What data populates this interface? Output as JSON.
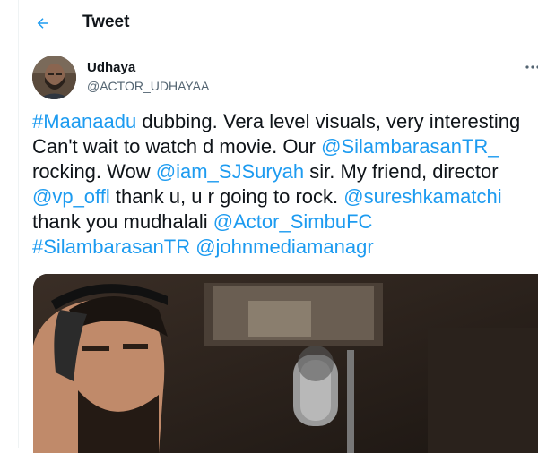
{
  "header": {
    "title": "Tweet",
    "back_icon": "arrow-left-icon",
    "accent_color": "#1d9bf0"
  },
  "tweet": {
    "author": {
      "name": "Udhaya",
      "handle": "@ACTOR_UDHAYAA"
    },
    "more_icon": "ellipsis-icon",
    "lines": [
      [
        {
          "text": "#Maanaadu",
          "link": true
        },
        {
          "text": " dubbing. Vera level visuals, very interesting",
          "link": false
        }
      ],
      [
        {
          "text": "Can't wait to watch d movie. Our ",
          "link": false
        },
        {
          "text": "@SilambarasanTR_",
          "link": true
        }
      ],
      [
        {
          "text": "rocking. Wow ",
          "link": false
        },
        {
          "text": "@iam_SJSuryah",
          "link": true
        },
        {
          "text": " sir. My friend, director",
          "link": false
        }
      ],
      [
        {
          "text": "@vp_offl",
          "link": true
        },
        {
          "text": " thank u, u r going to rock. ",
          "link": false
        },
        {
          "text": "@sureshkamatchi",
          "link": true
        }
      ],
      [
        {
          "text": "thank you mudhalali ",
          "link": false
        },
        {
          "text": "@Actor_SimbuFC",
          "link": true
        }
      ],
      [
        {
          "text": "#SilambarasanTR",
          "link": true
        },
        {
          "text": " ",
          "link": false
        },
        {
          "text": "@johnmediamanagr",
          "link": true
        }
      ]
    ],
    "media": {
      "type": "photo"
    }
  }
}
